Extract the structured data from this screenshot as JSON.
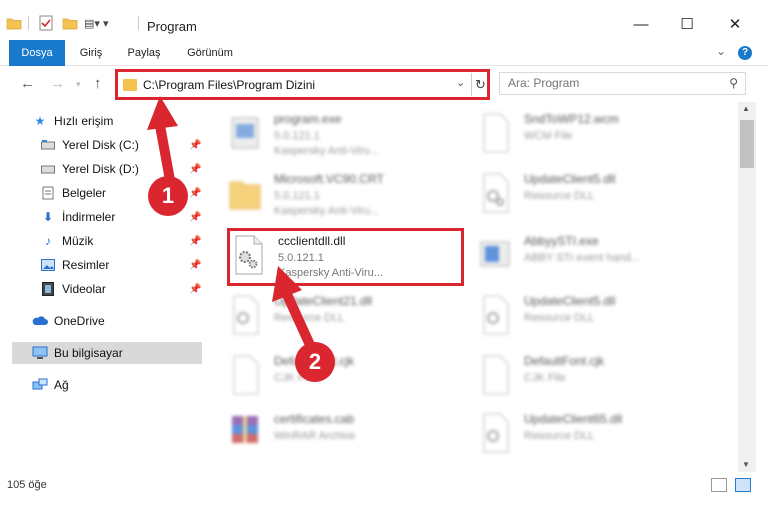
{
  "window": {
    "title": "Program",
    "minimize": "—",
    "maximize": "☐",
    "close": "✕"
  },
  "ribbon": {
    "tabs": [
      "Dosya",
      "Giriş",
      "Paylaş",
      "Görünüm"
    ],
    "active_tab": "Dosya"
  },
  "nav": {
    "address_path": "C:\\Program Files\\Program Dizini",
    "search_placeholder": "Ara: Program"
  },
  "sidebar": {
    "quick_access": "Hızlı erişim",
    "items": [
      {
        "label": "Yerel Disk (C:)",
        "icon": "drive-icon"
      },
      {
        "label": "Yerel Disk (D:)",
        "icon": "drive-icon"
      },
      {
        "label": "Belgeler",
        "icon": "documents-icon"
      },
      {
        "label": "İndirmeler",
        "icon": "download-icon"
      },
      {
        "label": "Müzik",
        "icon": "music-icon"
      },
      {
        "label": "Resimler",
        "icon": "pictures-icon"
      },
      {
        "label": "Videolar",
        "icon": "video-icon"
      }
    ],
    "onedrive": "OneDrive",
    "this_pc": "Bu bilgisayar",
    "network": "Ağ"
  },
  "files": [
    {
      "name": "program.exe",
      "line2": "5.0.121.1",
      "line3": "Kaspersky Anti-Viru..."
    },
    {
      "name": "SndToWP12.wcm",
      "line2": "WCM File",
      "line3": ""
    },
    {
      "name": "Microsoft.VC90.CRT",
      "line2": "5.0.121.1",
      "line3": "Kaspersky Anti-Viru..."
    },
    {
      "name": "UpdateClient5.dll",
      "line2": "Resource DLL",
      "line3": ""
    },
    {
      "name": "ccclientdll.dll",
      "line2": "5.0.121.1",
      "line3": "Kaspersky Anti-Viru..."
    },
    {
      "name": "AbbyySTI.exe",
      "line2": "ABBY STI event hand...",
      "line3": ""
    },
    {
      "name": "UpdateClient21.dll",
      "line2": "Resource DLL",
      "line3": ""
    },
    {
      "name": "UpdateClient5.dll",
      "line2": "Resource DLL",
      "line3": ""
    },
    {
      "name": "DefaultFont.cjk",
      "line2": "CJK File",
      "line3": ""
    },
    {
      "name": "DefaultFont.cjk",
      "line2": "CJK File",
      "line3": ""
    },
    {
      "name": "certificates.cab",
      "line2": "WinRAR Archive",
      "line3": ""
    },
    {
      "name": "UpdateClient65.dll",
      "line2": "Resource DLL",
      "line3": ""
    }
  ],
  "status": {
    "item_count": "105 öğe"
  },
  "callouts": [
    "1",
    "2"
  ],
  "colors": {
    "accent": "#1979ca",
    "highlight": "#d9262f"
  }
}
